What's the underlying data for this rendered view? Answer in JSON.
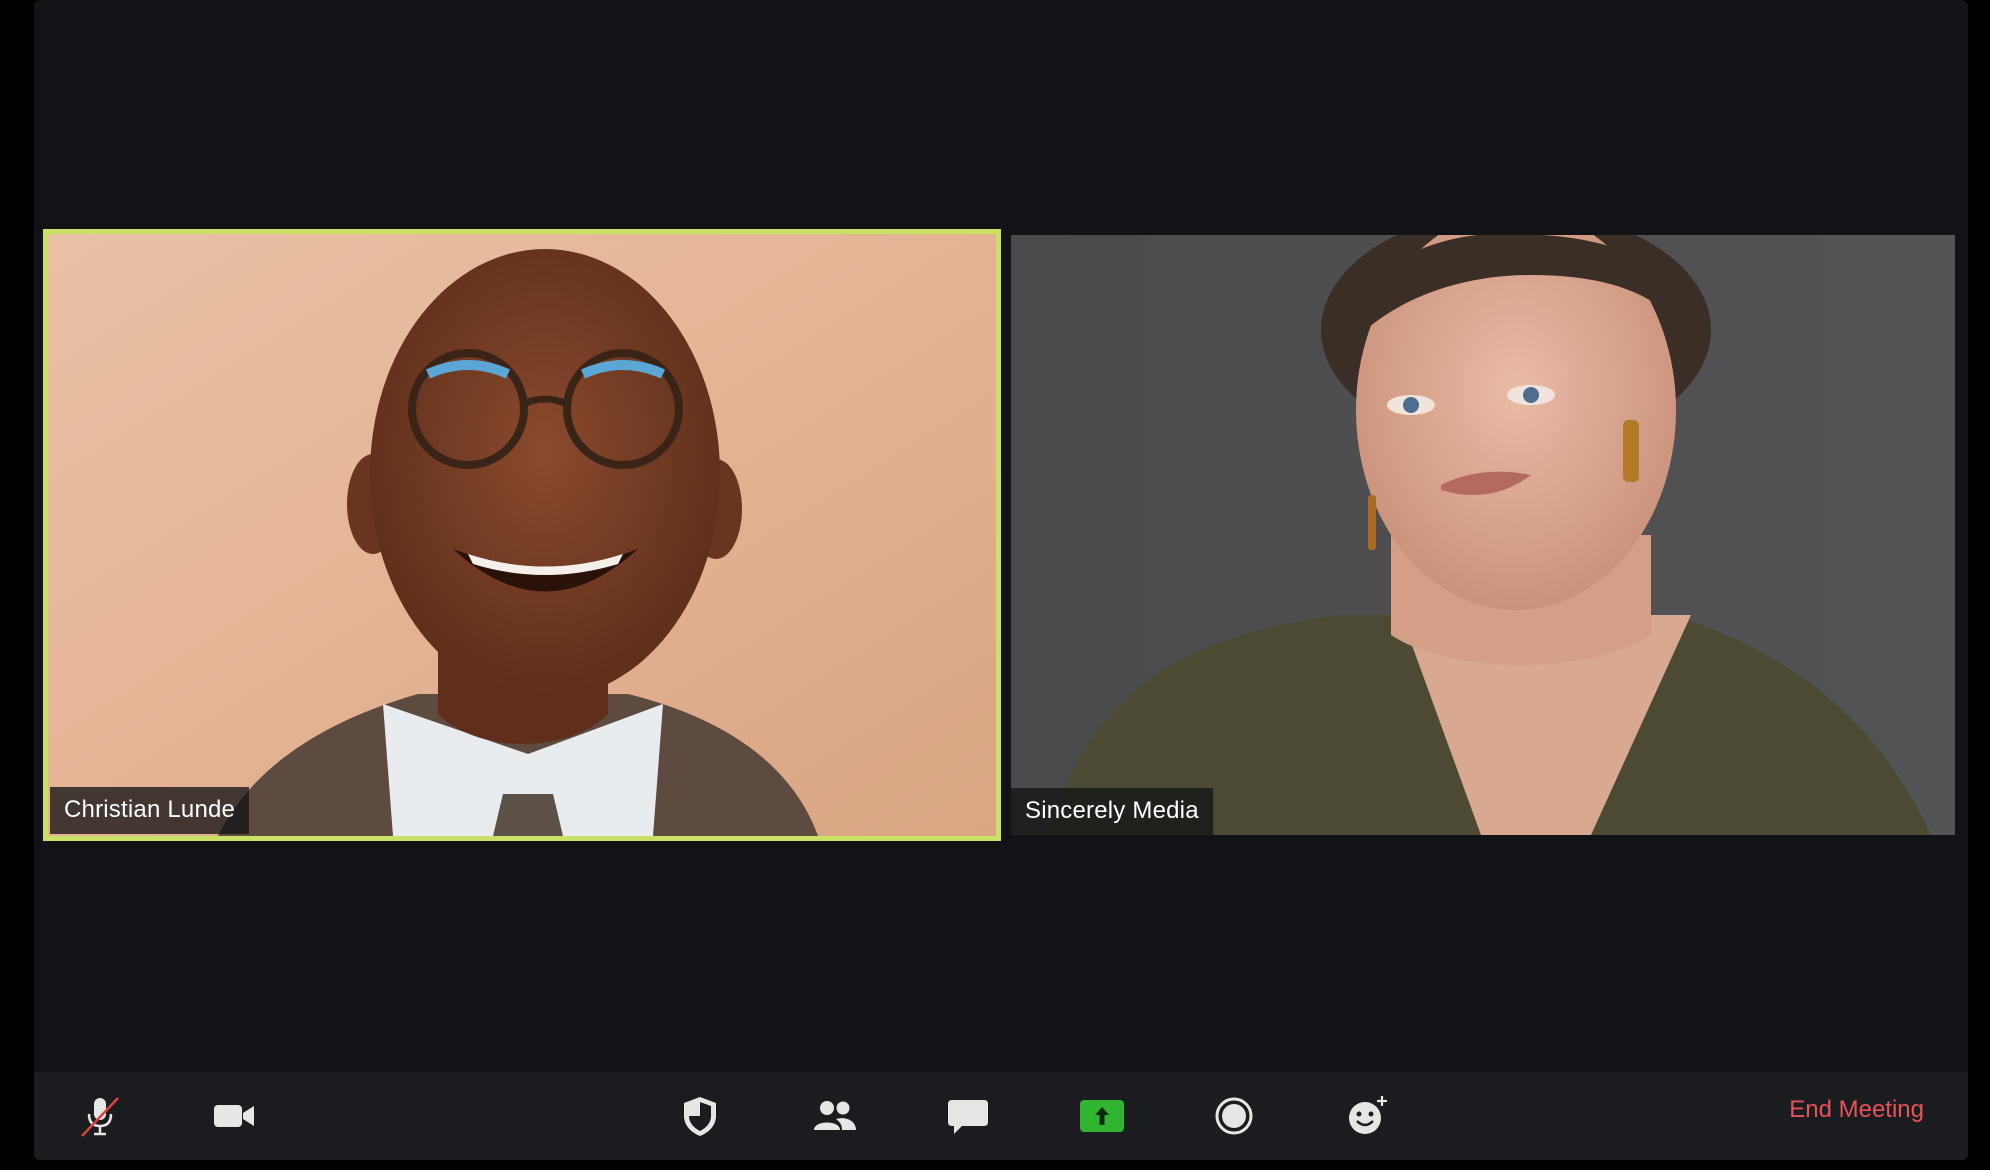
{
  "participants": [
    {
      "name": "Christian Lunde",
      "active_speaker": true
    },
    {
      "name": "Sincerely Media",
      "active_speaker": false
    }
  ],
  "toolbar": {
    "icons": [
      "mic-muted-icon",
      "video-camera-icon",
      "security-shield-icon",
      "participants-icon",
      "chat-icon",
      "share-screen-icon",
      "record-icon",
      "reactions-icon"
    ],
    "end_meeting_label": "End Meeting"
  },
  "colors": {
    "active_speaker_border": "#c9e265",
    "share_green": "#2fb52f",
    "end_meeting": "#e5535a",
    "background": "#121316",
    "toolbar": "#1b1c1f"
  }
}
